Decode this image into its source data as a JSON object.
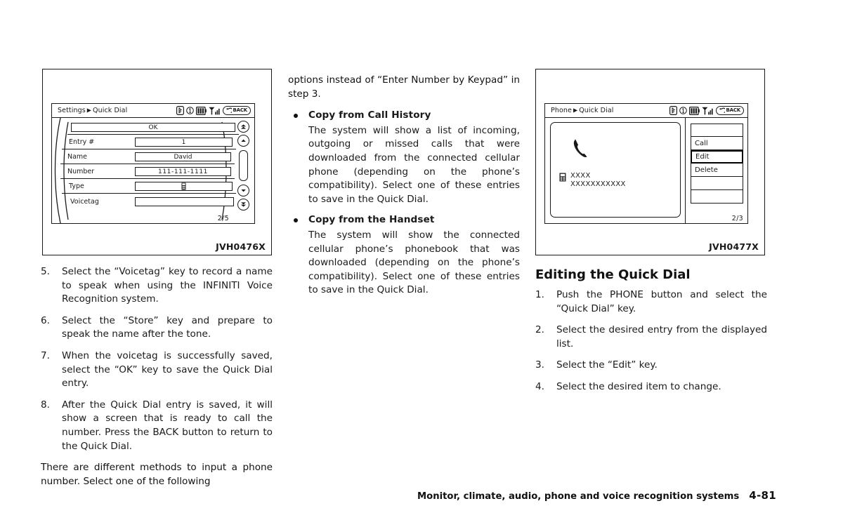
{
  "figures": [
    {
      "code": "JVH0476X",
      "breadcrumb_root": "Settings",
      "breadcrumb_leaf": "Quick Dial",
      "back_label": "BACK",
      "page_indicator": "2/5",
      "ok_label": "OK",
      "rows": [
        {
          "label": "Entry #",
          "value": "1"
        },
        {
          "label": "Name",
          "value": "David"
        },
        {
          "label": "Number",
          "value": "111-111-1111"
        },
        {
          "label": "Type",
          "value": ""
        },
        {
          "label": "Voicetag",
          "value": ""
        }
      ]
    },
    {
      "code": "JVH0477X",
      "breadcrumb_root": "Phone",
      "breadcrumb_leaf": "Quick Dial",
      "back_label": "BACK",
      "page_indicator": "2/3",
      "contact_name": "XXXX",
      "contact_number": "XXXXXXXXXXX",
      "menu": [
        {
          "label": "",
          "selected": false
        },
        {
          "label": "Call",
          "selected": false
        },
        {
          "label": "Edit",
          "selected": true
        },
        {
          "label": "Delete",
          "selected": false
        },
        {
          "label": "",
          "selected": false
        },
        {
          "label": "",
          "selected": false
        }
      ]
    }
  ],
  "left_column": {
    "steps": [
      {
        "marker": "5.",
        "text": "Select the “Voicetag” key to record a name to speak when using the INFINITI Voice Recognition system."
      },
      {
        "marker": "6.",
        "text": "Select the “Store” key and prepare to speak the name after the tone."
      },
      {
        "marker": "7.",
        "text": "When the voicetag is successfully saved, select the “OK” key to save the Quick Dial entry."
      },
      {
        "marker": "8.",
        "text": "After the Quick Dial entry is saved, it will show a screen that is ready to call the number. Press the BACK button to return to the Quick Dial."
      }
    ],
    "closing_paragraph": "There are different methods to input a phone number. Select one of the following"
  },
  "middle_column": {
    "intro_paragraph": "options instead of “Enter Number by Keypad” in step 3.",
    "bullets": [
      {
        "title": "Copy from Call History",
        "body": "The system will show a list of incoming, outgoing or missed calls that were downloaded from the connected cellular phone (depending on the phone’s compatibility). Select one of these entries to save in the Quick Dial."
      },
      {
        "title": "Copy from the Handset",
        "body": "The system will show the connected cellular phone’s phonebook that was downloaded (depending on the phone’s compatibility). Select one of these entries to save in the Quick Dial."
      }
    ]
  },
  "right_column": {
    "heading": "Editing the Quick Dial",
    "steps": [
      {
        "marker": "1.",
        "text": "Push the PHONE button and select the “Quick Dial” key."
      },
      {
        "marker": "2.",
        "text": "Select the desired entry from the displayed list."
      },
      {
        "marker": "3.",
        "text": "Select the “Edit” key."
      },
      {
        "marker": "4.",
        "text": "Select the desired item to change."
      }
    ]
  },
  "footer": {
    "text": "Monitor, climate, audio, phone and voice recognition systems",
    "page": "4-81"
  },
  "colors": {
    "ink": "#1a1a1a",
    "paper": "#ffffff"
  }
}
